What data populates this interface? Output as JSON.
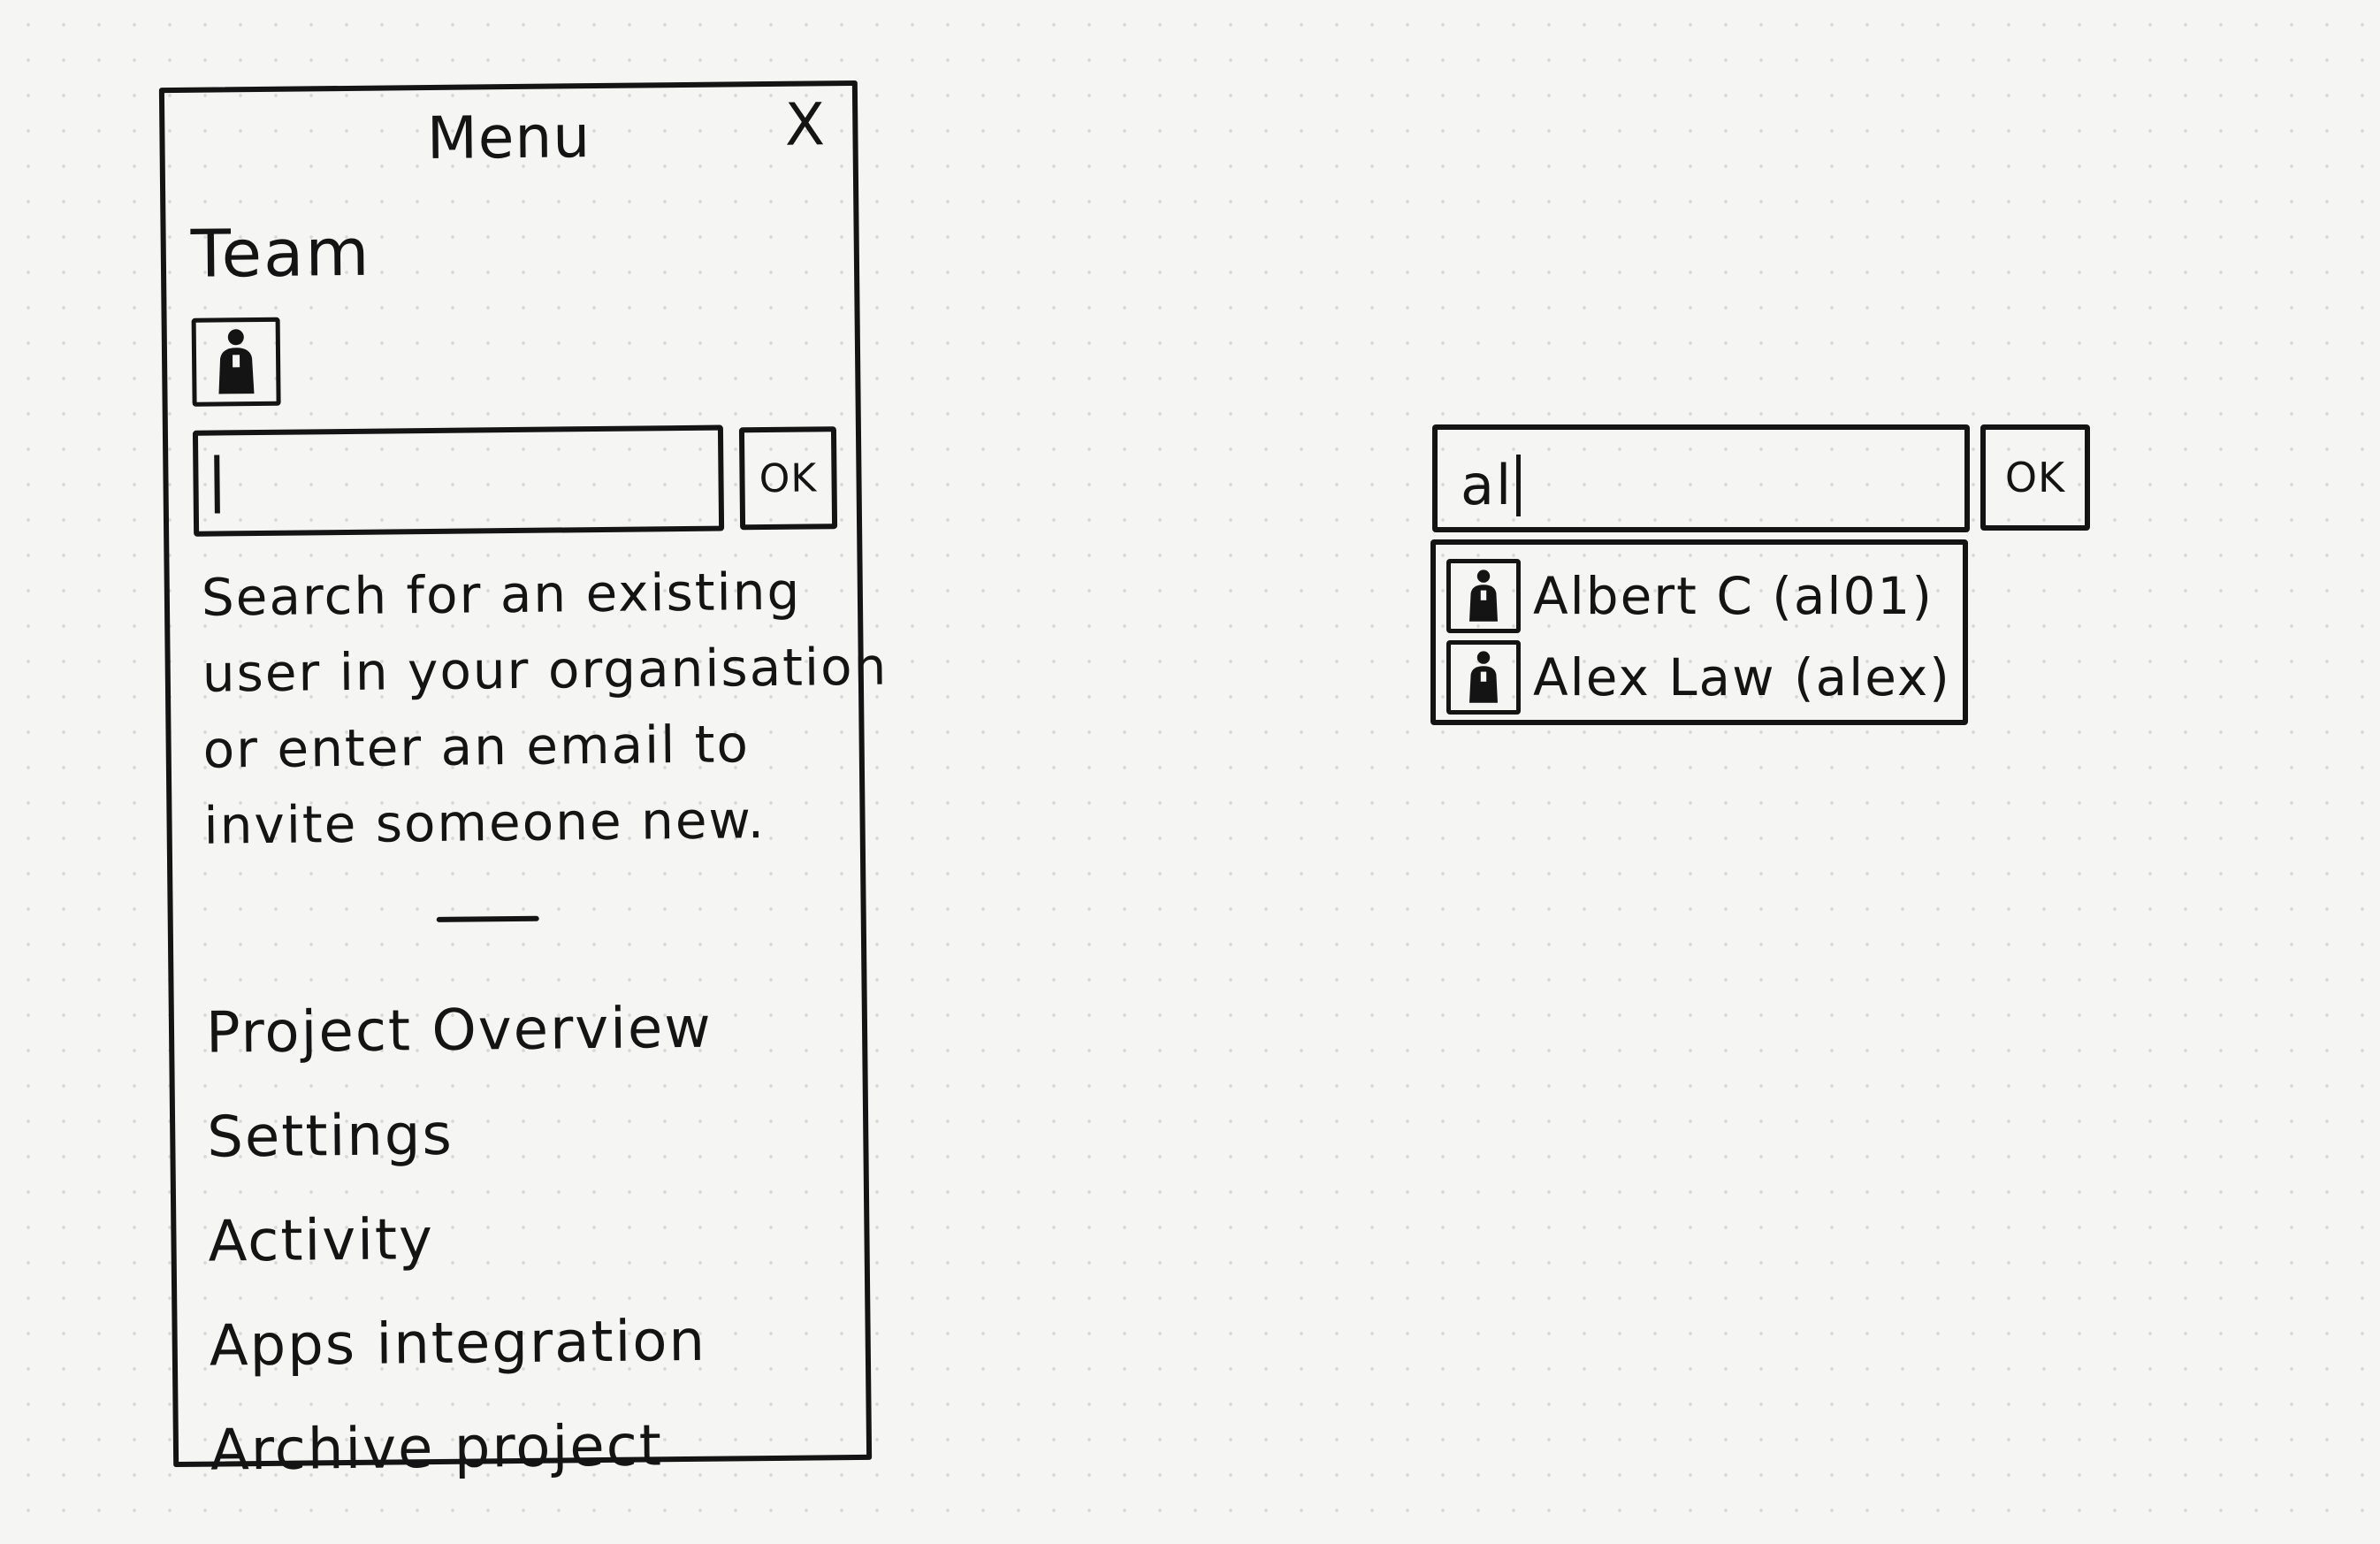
{
  "menu": {
    "title": "Menu",
    "close_symbol": "X",
    "team_heading": "Team",
    "avatar_icon": "user-avatar-icon",
    "invite": {
      "input_value": "",
      "ok_label": "OK"
    },
    "help_lines": [
      "Search for an existing",
      "user in your organisation",
      "or enter an email to",
      "invite someone new."
    ],
    "items": [
      {
        "label": "Project Overview"
      },
      {
        "label": "Settings"
      },
      {
        "label": "Activity"
      },
      {
        "label": "Apps integration"
      },
      {
        "label": "Archive project"
      }
    ]
  },
  "search": {
    "value": "al",
    "ok_label": "OK",
    "suggestions": [
      {
        "label": "Albert C (al01)",
        "icon": "user-avatar-icon"
      },
      {
        "label": "Alex Law (alex)",
        "icon": "user-avatar-icon"
      }
    ]
  },
  "colors": {
    "ink": "#141414",
    "paper": "#f5f5f3",
    "dot_grid": "#d9d9d6"
  }
}
